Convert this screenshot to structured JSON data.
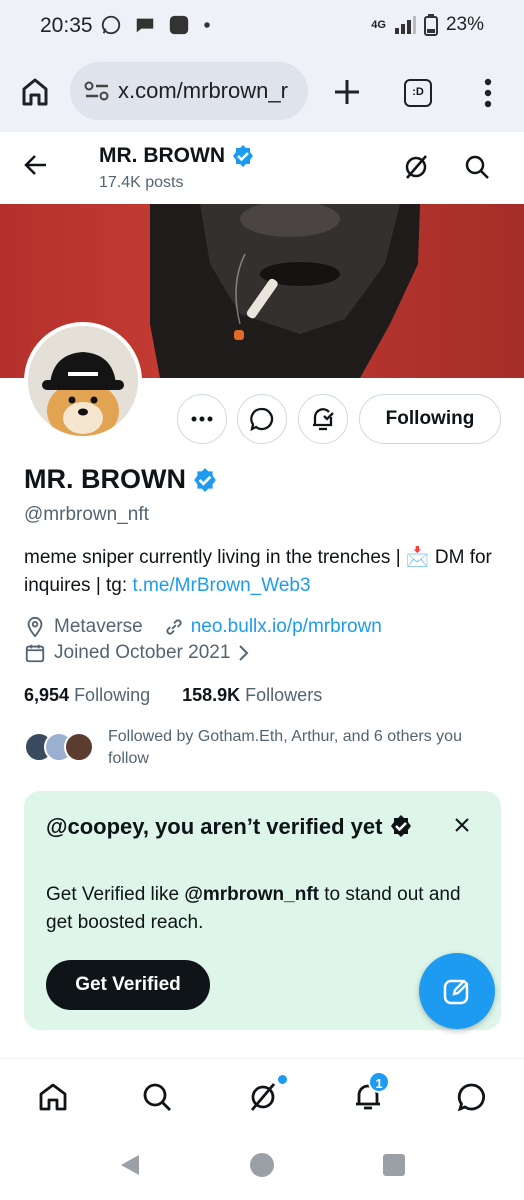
{
  "status_bar": {
    "time": "20:35",
    "battery": "23%",
    "network": "4G"
  },
  "browser": {
    "url": "x.com/mrbrown_r",
    "tab_label": ":D"
  },
  "header": {
    "name": "MR. BROWN",
    "posts": "17.4K posts"
  },
  "profile": {
    "display_name": "MR. BROWN",
    "handle": "@mrbrown_nft",
    "follow_label": "Following",
    "bio_text": "meme sniper currently living in the trenches | 📩 DM for inquires | tg: ",
    "bio_link": "t.me/MrBrown_Web3",
    "location": "Metaverse",
    "website": "neo.bullx.io/p/mrbrown",
    "joined": "Joined October 2021",
    "following_count": "6,954",
    "following_label": "Following",
    "followers_count": "158.9K",
    "followers_label": "Followers",
    "followed_by": "Followed by Gotham.Eth, Arthur, and 6 others you follow"
  },
  "verify_card": {
    "title": "@coopey, you aren’t verified yet",
    "body_prefix": "Get Verified like ",
    "body_handle": "@mrbrown_nft",
    "body_suffix": " to stand out and get boosted reach.",
    "button": "Get Verified"
  },
  "nav": {
    "notifications_badge": "1"
  },
  "colors": {
    "accent": "#1d9bf0",
    "verify_bg": "#def6e9",
    "banner": "#b4312b"
  }
}
